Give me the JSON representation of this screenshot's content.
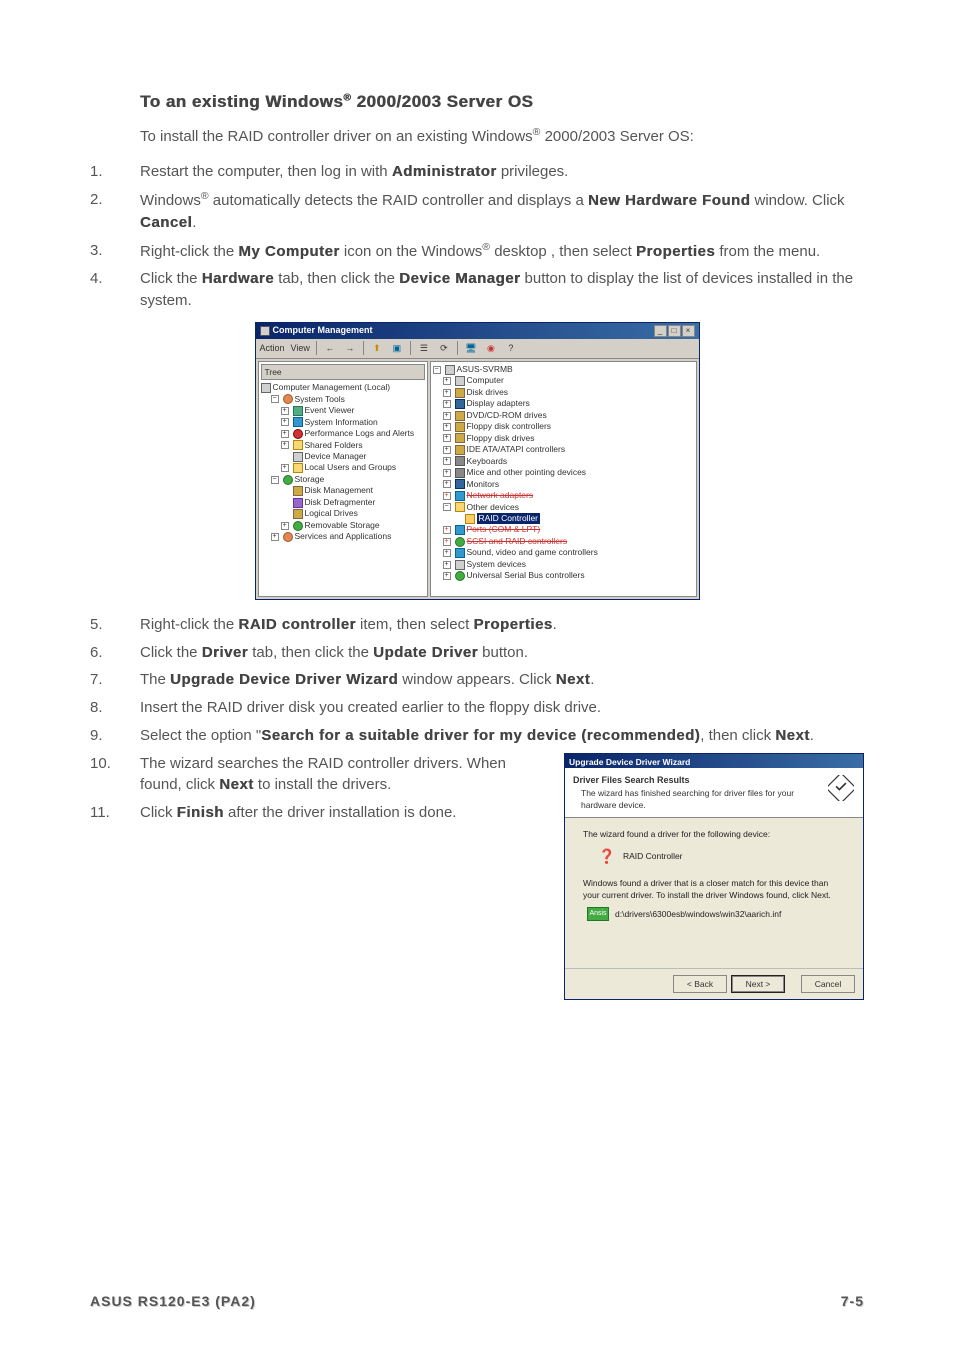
{
  "heading": {
    "prefix": "To an existing Windows",
    "suffix": " 2000/2003 Server OS"
  },
  "intro": {
    "l1": "To install the RAID controller driver on an existing Windows",
    "l2": " 2000/2003 Server OS:"
  },
  "steps_a": [
    {
      "num": "1.",
      "pre": "Restart the computer, then log in with ",
      "b1": "Administrator",
      "post": " privileges."
    },
    {
      "num": "2.",
      "pre": "Windows",
      "sup": "®",
      "mid": " automatically detects the RAID controller and displays a ",
      "b1": "New Hardware Found",
      "mid2": " window. Click ",
      "b2": "Cancel",
      "post": "."
    },
    {
      "num": "3.",
      "pre": "Right-click the ",
      "b1": "My Computer",
      "mid": " icon on the Windows",
      "sup2": "®",
      "mid2": " desktop , then select ",
      "b2": "Properties",
      "post": " from the menu."
    },
    {
      "num": "4.",
      "pre": "Click the ",
      "b1": "Hardware",
      "mid": " tab, then click the ",
      "b2": "Device Manager",
      "post": " button to display the list of devices installed in the system."
    }
  ],
  "cm": {
    "title": "Computer Management",
    "menu_action": "Action",
    "menu_view": "View",
    "tree_hdr": "Tree",
    "left": [
      "Computer Management (Local)",
      "System Tools",
      "Event Viewer",
      "System Information",
      "Performance Logs and Alerts",
      "Shared Folders",
      "Device Manager",
      "Local Users and Groups",
      "Storage",
      "Disk Management",
      "Disk Defragmenter",
      "Logical Drives",
      "Removable Storage",
      "Services and Applications"
    ],
    "right": [
      "ASUS-SVRMB",
      "Computer",
      "Disk drives",
      "Display adapters",
      "DVD/CD-ROM drives",
      "Floppy disk controllers",
      "Floppy disk drives",
      "IDE ATA/ATAPI controllers",
      "Keyboards",
      "Mice and other pointing devices",
      "Monitors",
      "Network adapters",
      "Other devices",
      "RAID Controller",
      "Ports (COM & LPT)",
      "SCSI and RAID controllers",
      "Sound, video and game controllers",
      "System devices",
      "Universal Serial Bus controllers"
    ]
  },
  "steps_b": [
    {
      "num": "5.",
      "pre": "Right-click the ",
      "b1": "RAID controller",
      "mid": " item, then select ",
      "b2": "Properties",
      "post": "."
    },
    {
      "num": "6.",
      "pre": "Click the ",
      "b1": "Driver",
      "mid": " tab, then click the ",
      "b2": "Update Driver",
      "post": " button."
    },
    {
      "num": "7.",
      "pre": "The ",
      "b1": "Upgrade Device Driver Wizard",
      "mid": " window appears. Click ",
      "b2": "Next",
      "post": "."
    },
    {
      "num": "8.",
      "text": "Insert the RAID driver disk you created earlier to the floppy disk drive."
    },
    {
      "num": "9.",
      "pre": "Select the option \"",
      "b1": "Search for a suitable driver for my device (recommended)",
      "mid": ", then click ",
      "b2": "Next",
      "post": "."
    }
  ],
  "steps_c": [
    {
      "num": "10.",
      "pre": "The wizard searches the RAID controller drivers. When found, click ",
      "b1": "Next",
      "post": " to install the drivers."
    },
    {
      "num": "11.",
      "pre": "Click ",
      "b1": "Finish",
      "post": " after the driver installation is done."
    }
  ],
  "wiz": {
    "title": "Upgrade Device Driver Wizard",
    "h_title": "Driver Files Search Results",
    "h_sub": "The wizard has finished searching for driver files for your hardware device.",
    "body1": "The wizard found a driver for the following device:",
    "dev": "RAID Controller",
    "body2": "Windows found a driver that is a closer match for this device than your current driver. To install the driver Windows found, click Next.",
    "path_label": "Ansis",
    "path": "d:\\drivers\\6300esb\\windows\\win32\\aarich.inf",
    "btn_back": "< Back",
    "btn_next": "Next >",
    "btn_cancel": "Cancel"
  },
  "footer": {
    "left": "ASUS RS120-E3 (PA2)",
    "right": "7-5"
  }
}
